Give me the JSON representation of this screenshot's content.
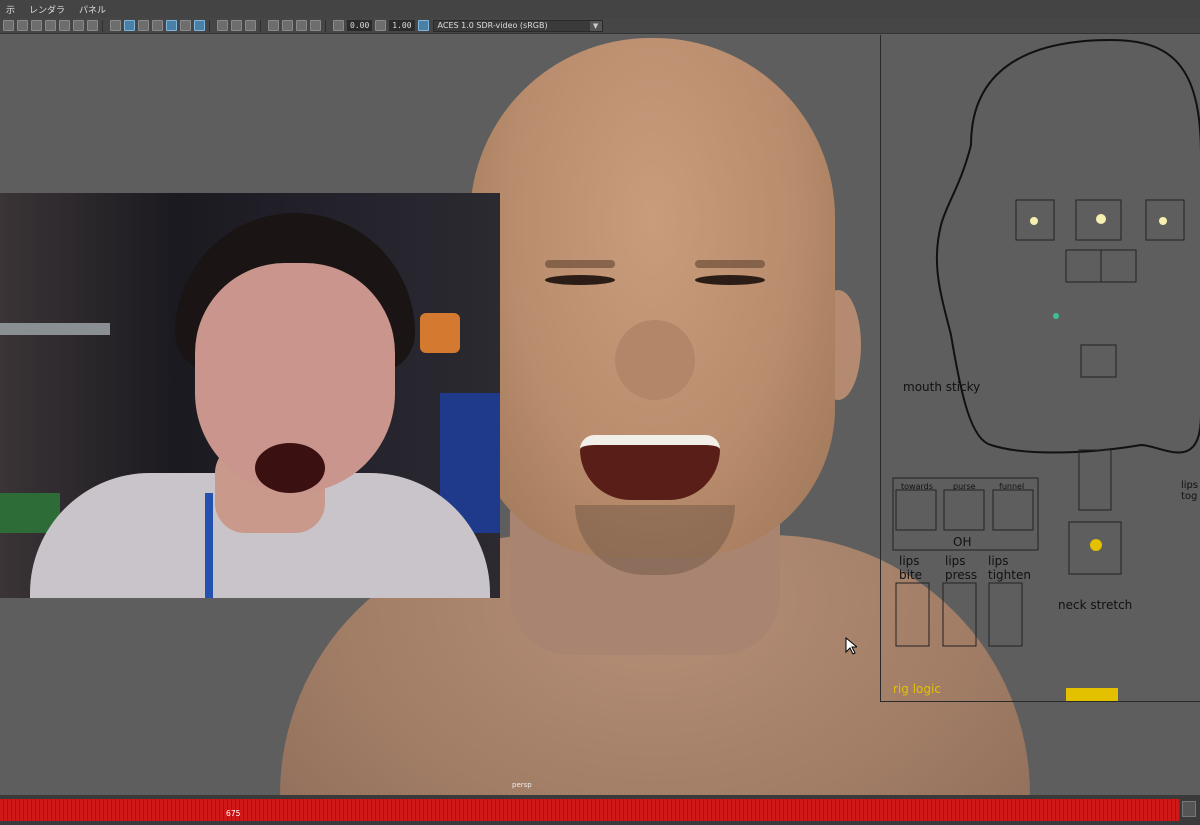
{
  "menu": {
    "items": [
      "示",
      "レンダラ",
      "パネル"
    ]
  },
  "toolbar": {
    "exposure": "0.00",
    "gamma": "1.00",
    "colorspace": "ACES 1.0 SDR-video (sRGB)"
  },
  "viewport": {
    "camera": "persp"
  },
  "rig_panel": {
    "mouth_sticky": "mouth sticky",
    "towards": "towards",
    "purse": "purse",
    "funnel": "funnel",
    "oh": "OH",
    "lips_bite_1": "lips",
    "lips_bite_2": "bite",
    "lips_press_1": "lips",
    "lips_press_2": "press",
    "lips_tighten_1": "lips",
    "lips_tighten_2": "tighten",
    "neck_stretch": "neck stretch",
    "rig_logic": "rig logic",
    "lips_toggle_1": "lips",
    "lips_toggle_2": "tog"
  },
  "timeline": {
    "current_frame": "675"
  },
  "colors": {
    "timeline_keys": "#d01818",
    "rig_accent": "#e3c000"
  }
}
